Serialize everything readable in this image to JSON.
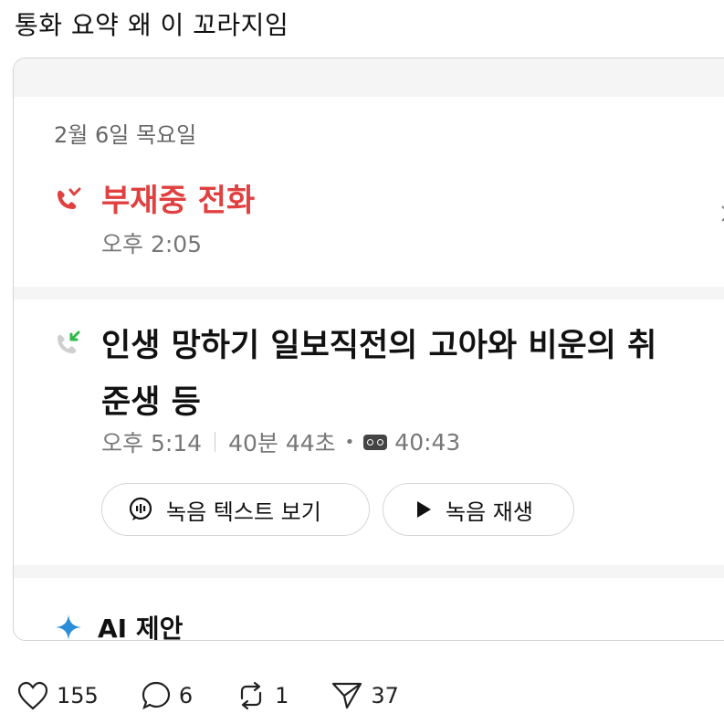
{
  "post": {
    "text": "통화 요약 왜 이 꼬라지임"
  },
  "call_log": {
    "date": "2월 6일 목요일",
    "missed_call": {
      "title": "부재중 전화",
      "time": "오후 2:05",
      "icon": "missed-call-icon",
      "color": "#e0403f"
    },
    "incoming_call": {
      "title": "인생 망하기 일보직전의 고아와 비운의 취준생 등",
      "time": "오후 5:14",
      "duration": "40분 44초",
      "dot": "•",
      "recording_length": "40:43",
      "icon": "incoming-call-icon",
      "icon_color": "#2fb94a"
    },
    "buttons": {
      "transcript": "녹음 텍스트 보기",
      "play": "녹음 재생"
    },
    "ai_section": {
      "label": "AI 제안",
      "icon": "sparkle-icon",
      "icon_color": "#2b8cd8"
    }
  },
  "actions": {
    "likes": "155",
    "comments": "6",
    "reposts": "1",
    "shares": "37"
  }
}
